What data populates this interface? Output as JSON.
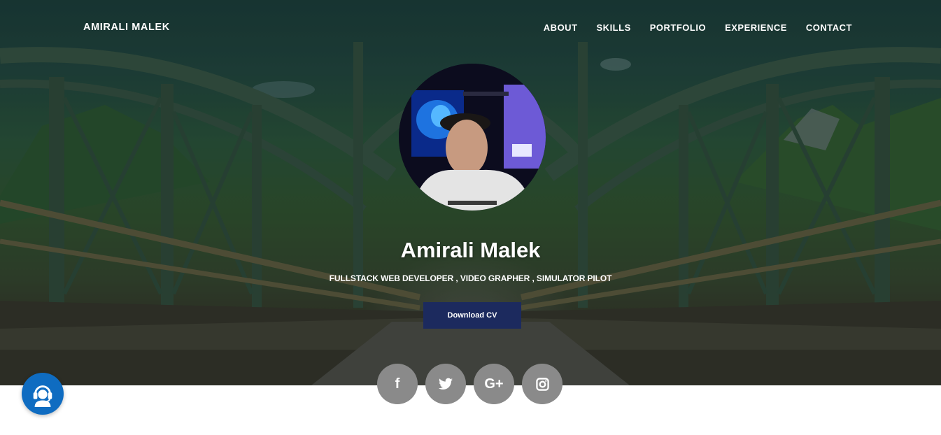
{
  "brand": "AMIRALI MALEK",
  "nav": {
    "about": "ABOUT",
    "skills": "SKILLS",
    "portfolio": "PORTFOLIO",
    "experience": "EXPERIENCE",
    "contact": "CONTACT"
  },
  "hero": {
    "name": "Amirali Malek",
    "subtitle": "FULLSTACK WEB DEVELOPER , VIDEO GRAPHER , SIMULATOR PILOT",
    "cv_button": "Download CV"
  },
  "socials": {
    "facebook_glyph": "f",
    "twitter_icon": "twitter-icon",
    "googleplus_glyph": "G+",
    "instagram_icon": "instagram-icon"
  },
  "support_icon": "headset-support-icon",
  "colors": {
    "cv_button": "#1c2a5e",
    "social_bg": "#8a8a8a",
    "support_bg": "#0f6cc1"
  }
}
